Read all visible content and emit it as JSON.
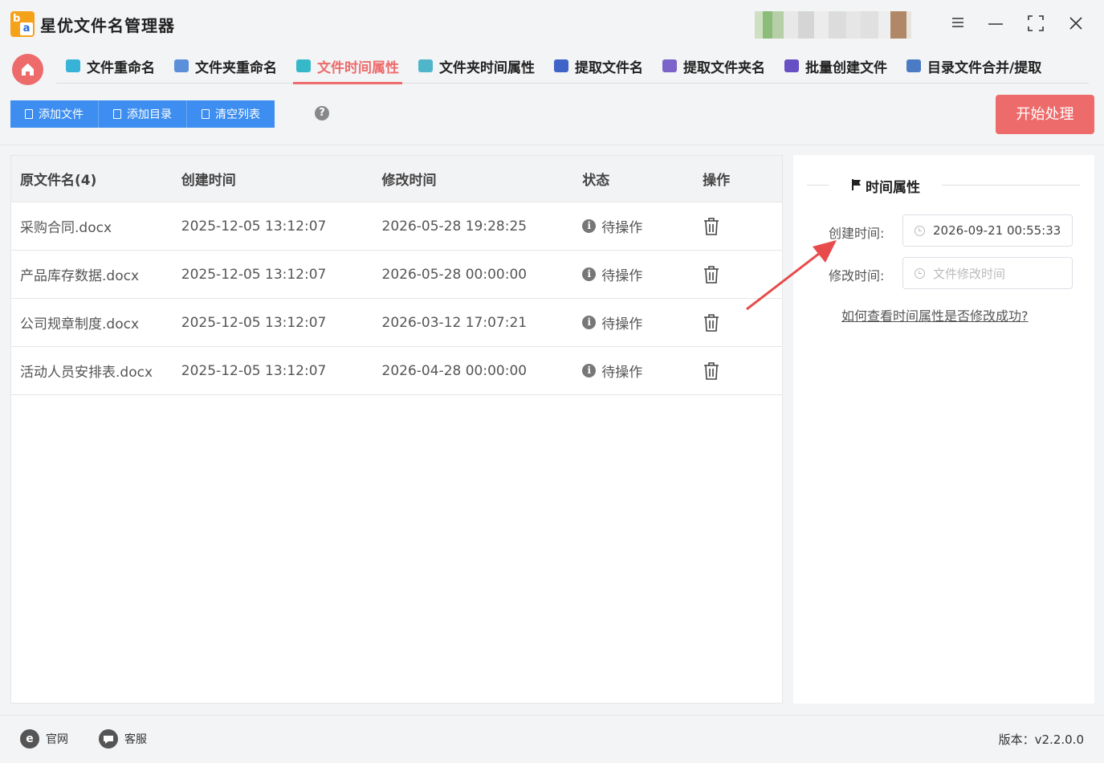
{
  "app": {
    "title": "星优文件名管理器",
    "logo_letters": [
      "b",
      "a"
    ]
  },
  "window_controls": {
    "menu_icon": "menu-icon",
    "minimize_icon": "minimize-icon",
    "maximize_icon": "maximize-icon",
    "close_icon": "close-icon"
  },
  "nav": {
    "home_icon": "home-icon",
    "tabs": [
      {
        "label": "文件重命名",
        "icon": "file-rename-icon",
        "icon_color": "#36b3d6"
      },
      {
        "label": "文件夹重命名",
        "icon": "folder-rename-icon",
        "icon_color": "#5b8fd9"
      },
      {
        "label": "文件时间属性",
        "icon": "file-time-icon",
        "icon_color": "#35b9c9",
        "active": true
      },
      {
        "label": "文件夹时间属性",
        "icon": "folder-time-icon",
        "icon_color": "#4fb6c9"
      },
      {
        "label": "提取文件名",
        "icon": "extract-filename-icon",
        "icon_color": "#3f63c6"
      },
      {
        "label": "提取文件夹名",
        "icon": "extract-foldername-icon",
        "icon_color": "#7a63c9"
      },
      {
        "label": "批量创建文件",
        "icon": "batch-create-icon",
        "icon_color": "#6650c4"
      },
      {
        "label": "目录文件合并/提取",
        "icon": "merge-extract-icon",
        "icon_color": "#4a7bc4"
      }
    ]
  },
  "toolbar": {
    "add_file_label": "添加文件",
    "add_dir_label": "添加目录",
    "clear_list_label": "清空列表",
    "help_icon": "help-icon",
    "start_label": "开始处理"
  },
  "table": {
    "headers": [
      "原文件名(4)",
      "创建时间",
      "修改时间",
      "状态",
      "操作"
    ],
    "rows": [
      {
        "name": "采购合同.docx",
        "created": "2025-12-05 13:12:07",
        "modified": "2026-05-28 19:28:25",
        "status": "待操作"
      },
      {
        "name": "产品库存数据.docx",
        "created": "2025-12-05 13:12:07",
        "modified": "2026-05-28 00:00:00",
        "status": "待操作"
      },
      {
        "name": "公司规章制度.docx",
        "created": "2025-12-05 13:12:07",
        "modified": "2026-03-12 17:07:21",
        "status": "待操作"
      },
      {
        "name": "活动人员安排表.docx",
        "created": "2025-12-05 13:12:07",
        "modified": "2026-04-28 00:00:00",
        "status": "待操作"
      }
    ]
  },
  "side": {
    "title": "时间属性",
    "created_label": "创建时间:",
    "created_value": "2026-09-21 00:55:33",
    "modified_label": "修改时间:",
    "modified_placeholder": "文件修改时间",
    "help_link": "如何查看时间属性是否修改成功?"
  },
  "footer": {
    "website_label": "官网",
    "service_label": "客服",
    "version": "版本：v2.2.0.0"
  },
  "colors": {
    "accent": "#ee6b6b",
    "primary": "#3d8ef0",
    "arrow": "#e84b4b"
  }
}
